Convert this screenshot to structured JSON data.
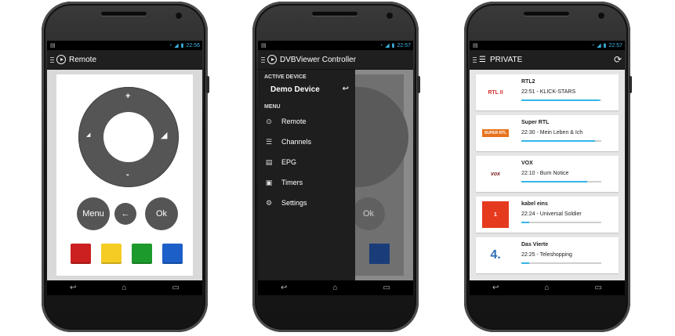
{
  "screens": [
    {
      "status_time": "22:56",
      "title": "Remote",
      "dpad": {
        "up": "+",
        "down": "-",
        "left": "◢",
        "right": "◢"
      },
      "buttons": {
        "menu": "Menu",
        "back": "←",
        "ok": "Ok"
      },
      "colors": [
        "#cc1f1f",
        "#f5cc23",
        "#1d9a2c",
        "#1d5fc8"
      ]
    },
    {
      "status_time": "22:57",
      "title": "DVBViewer Controller",
      "active_device_heading": "ACTIVE DEVICE",
      "device": "Demo Device",
      "menu_heading": "MENU",
      "menu": [
        {
          "label": "Remote",
          "icon": "play-icon"
        },
        {
          "label": "Channels",
          "icon": "list-icon"
        },
        {
          "label": "EPG",
          "icon": "clipboard-icon"
        },
        {
          "label": "Timers",
          "icon": "calendar-icon"
        },
        {
          "label": "Settings",
          "icon": "sliders-icon"
        }
      ],
      "peek_ok": "Ok"
    },
    {
      "status_time": "22:57",
      "title": "PRIVATE",
      "channels": [
        {
          "name": "RTL2",
          "time": "22:51",
          "show": "KLICK-STARS",
          "progress": 0.98,
          "logo": "RTL II"
        },
        {
          "name": "Super RTL",
          "time": "22:30",
          "show": "Mein Leben & Ich",
          "progress": 0.92,
          "logo": "SUPER RTL"
        },
        {
          "name": "VOX",
          "time": "22:10",
          "show": "Burn Notice",
          "progress": 0.82,
          "logo": "vox"
        },
        {
          "name": "kabel eins",
          "time": "22:24",
          "show": "Universal Soldier",
          "progress": 0.1,
          "logo": "1"
        },
        {
          "name": "Das Vierte",
          "time": "22:25",
          "show": "Teleshopping",
          "progress": 0.1,
          "logo": "4."
        }
      ]
    }
  ]
}
